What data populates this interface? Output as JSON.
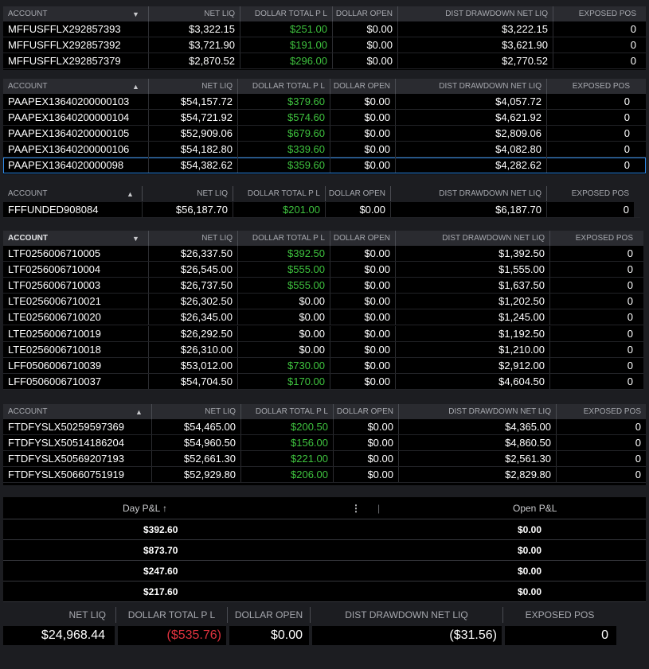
{
  "headers": {
    "account": "ACCOUNT",
    "net_liq": "NET LIQ",
    "dollar_total_pl": "DOLLAR TOTAL P L",
    "dollar_open": "DOLLAR OPEN",
    "dist_drawdown": "DIST DRAWDOWN NET LIQ",
    "exposed_pos": "EXPOSED POS"
  },
  "sort_icons": {
    "down": "▼",
    "up": "▲"
  },
  "group1": [
    {
      "account": "MFFUSFFLX292857393",
      "net_liq": "$3,322.15",
      "pl": "$251.00",
      "open": "$0.00",
      "dist": "$3,222.15",
      "pos": "0"
    },
    {
      "account": "MFFUSFFLX292857392",
      "net_liq": "$3,721.90",
      "pl": "$191.00",
      "open": "$0.00",
      "dist": "$3,621.90",
      "pos": "0"
    },
    {
      "account": "MFFUSFFLX292857379",
      "net_liq": "$2,870.52",
      "pl": "$296.00",
      "open": "$0.00",
      "dist": "$2,770.52",
      "pos": "0"
    }
  ],
  "group2": [
    {
      "account": "PAAPEX13640200000103",
      "net_liq": "$54,157.72",
      "pl": "$379.60",
      "open": "$0.00",
      "dist": "$4,057.72",
      "pos": "0"
    },
    {
      "account": "PAAPEX13640200000104",
      "net_liq": "$54,721.92",
      "pl": "$574.60",
      "open": "$0.00",
      "dist": "$4,621.92",
      "pos": "0"
    },
    {
      "account": "PAAPEX13640200000105",
      "net_liq": "$52,909.06",
      "pl": "$679.60",
      "open": "$0.00",
      "dist": "$2,809.06",
      "pos": "0"
    },
    {
      "account": "PAAPEX13640200000106",
      "net_liq": "$54,182.80",
      "pl": "$339.60",
      "open": "$0.00",
      "dist": "$4,082.80",
      "pos": "0"
    },
    {
      "account": "PAAPEX1364020000098",
      "net_liq": "$54,382.62",
      "pl": "$359.60",
      "open": "$0.00",
      "dist": "$4,282.62",
      "pos": "0"
    }
  ],
  "group3": [
    {
      "account": "FFFUNDED908084",
      "net_liq": "$56,187.70",
      "pl": "$201.00",
      "open": "$0.00",
      "dist": "$6,187.70",
      "pos": "0"
    }
  ],
  "group4": [
    {
      "account": "LTF0256006710005",
      "net_liq": "$26,337.50",
      "pl": "$392.50",
      "open": "$0.00",
      "dist": "$1,392.50",
      "pos": "0",
      "green": true
    },
    {
      "account": "LTF0256006710004",
      "net_liq": "$26,545.00",
      "pl": "$555.00",
      "open": "$0.00",
      "dist": "$1,555.00",
      "pos": "0",
      "green": true
    },
    {
      "account": "LTF0256006710003",
      "net_liq": "$26,737.50",
      "pl": "$555.00",
      "open": "$0.00",
      "dist": "$1,637.50",
      "pos": "0",
      "green": true
    },
    {
      "account": "LTE0256006710021",
      "net_liq": "$26,302.50",
      "pl": "$0.00",
      "open": "$0.00",
      "dist": "$1,202.50",
      "pos": "0",
      "green": false
    },
    {
      "account": "LTE0256006710020",
      "net_liq": "$26,345.00",
      "pl": "$0.00",
      "open": "$0.00",
      "dist": "$1,245.00",
      "pos": "0",
      "green": false
    },
    {
      "account": "LTE0256006710019",
      "net_liq": "$26,292.50",
      "pl": "$0.00",
      "open": "$0.00",
      "dist": "$1,192.50",
      "pos": "0",
      "green": false
    },
    {
      "account": "LTE0256006710018",
      "net_liq": "$26,310.00",
      "pl": "$0.00",
      "open": "$0.00",
      "dist": "$1,210.00",
      "pos": "0",
      "green": false
    },
    {
      "account": "LFF0506006710039",
      "net_liq": "$53,012.00",
      "pl": "$730.00",
      "open": "$0.00",
      "dist": "$2,912.00",
      "pos": "0",
      "green": true
    },
    {
      "account": "LFF0506006710037",
      "net_liq": "$54,704.50",
      "pl": "$170.00",
      "open": "$0.00",
      "dist": "$4,604.50",
      "pos": "0",
      "green": true
    }
  ],
  "group5": [
    {
      "account": "FTDFYSLX50259597369",
      "net_liq": "$54,465.00",
      "pl": "$200.50",
      "open": "$0.00",
      "dist": "$4,365.00",
      "pos": "0"
    },
    {
      "account": "FTDFYSLX50514186204",
      "net_liq": "$54,960.50",
      "pl": "$156.00",
      "open": "$0.00",
      "dist": "$4,860.50",
      "pos": "0"
    },
    {
      "account": "FTDFYSLX50569207193",
      "net_liq": "$52,661.30",
      "pl": "$221.00",
      "open": "$0.00",
      "dist": "$2,561.30",
      "pos": "0"
    },
    {
      "account": "FTDFYSLX50660751919",
      "net_liq": "$52,929.80",
      "pl": "$206.00",
      "open": "$0.00",
      "dist": "$2,829.80",
      "pos": "0"
    }
  ],
  "pnl": {
    "day_header": "Day P&L",
    "sort_icon": "↑",
    "menu_icon": "⋮",
    "separator": "|",
    "open_header": "Open P&L",
    "rows": [
      {
        "day": "$392.60",
        "open": "$0.00"
      },
      {
        "day": "$873.70",
        "open": "$0.00"
      },
      {
        "day": "$247.60",
        "open": "$0.00"
      },
      {
        "day": "$217.60",
        "open": "$0.00"
      }
    ]
  },
  "totals": {
    "net_liq": "$24,968.44",
    "dollar_total_pl": "($535.76)",
    "dollar_open": "$0.00",
    "dist_drawdown": "($31.56)",
    "exposed_pos": "0"
  },
  "colors": {
    "positive": "#3ec23e",
    "negative": "#e0323e",
    "selection": "#2f8ae8"
  }
}
